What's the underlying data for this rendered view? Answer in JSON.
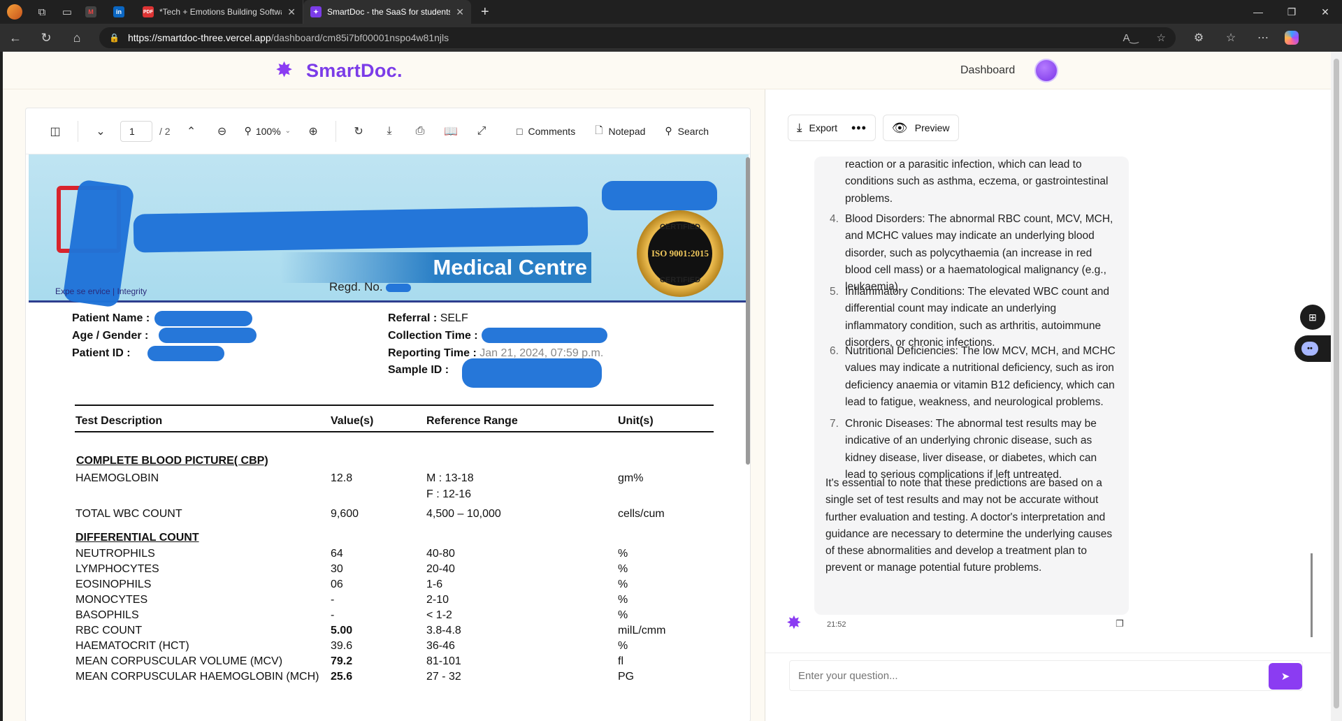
{
  "browser": {
    "tabs": [
      {
        "title": "",
        "favicon": "m-gmail"
      },
      {
        "title": "",
        "favicon": "linkedin"
      },
      {
        "title": "*Tech + Emotions Building Softwa",
        "favicon": "pdf"
      },
      {
        "title": "SmartDoc - the SaaS for students",
        "favicon": "smartdoc",
        "active": true
      }
    ],
    "url_host": "https://smartdoc-three.vercel.app",
    "url_path": "/dashboard/cm85i7bf00001nspo4w81njls"
  },
  "header": {
    "brand": "SmartDoc.",
    "nav_dashboard": "Dashboard"
  },
  "pdf_toolbar": {
    "page_current": "1",
    "page_total": "/ 2",
    "zoom": "100%",
    "comments": "Comments",
    "notepad": "Notepad",
    "search": "Search"
  },
  "report": {
    "lab_banner": "Medical Centre",
    "lab_tagline": "Expe se ervice | Integrity",
    "regd": "Regd. No.",
    "iso_top": "CERTIFIED",
    "iso_mid": "ISO 9001:2015",
    "iso_bot": "CERTIFIED",
    "patient_name_label": "Patient Name :",
    "age_gender_label": "Age / Gender :",
    "patient_id_label": "Patient ID :",
    "referral_label": "Referral :",
    "referral_value": "SELF",
    "collection_label": "Collection Time :",
    "reporting_label": "Reporting Time :",
    "reporting_value": "Jan 21, 2024, 07:59 p.m.",
    "sample_label": "Sample ID :",
    "columns": [
      "Test Description",
      "Value(s)",
      "Reference Range",
      "Unit(s)"
    ],
    "section_cbp": "COMPLETE BLOOD PICTURE( CBP)",
    "section_diff": "DIFFERENTIAL COUNT",
    "rows_top": [
      {
        "name": "HAEMOGLOBIN",
        "value": "12.8",
        "range": "M : 13-18",
        "range2": "F : 12-16",
        "unit": "gm%"
      },
      {
        "name": "TOTAL WBC COUNT",
        "value": "9,600",
        "range": "4,500 – 10,000",
        "unit": "cells/cum"
      }
    ],
    "rows_diff": [
      {
        "name": "NEUTROPHILS",
        "value": "64",
        "range": "40-80",
        "unit": "%"
      },
      {
        "name": "LYMPHOCYTES",
        "value": "30",
        "range": "20-40",
        "unit": "%"
      },
      {
        "name": "EOSINOPHILS",
        "value": "06",
        "range": "1-6",
        "unit": "%"
      },
      {
        "name": "MONOCYTES",
        "value": "-",
        "range": "2-10",
        "unit": "%"
      },
      {
        "name": "BASOPHILS",
        "value": "-",
        "range": "< 1-2",
        "unit": "%"
      },
      {
        "name": "RBC COUNT",
        "value": "5.00",
        "range": "3.8-4.8",
        "unit": "milL/cmm",
        "bold": true
      },
      {
        "name": "HAEMATOCRIT (HCT)",
        "value": "39.6",
        "range": "36-46",
        "unit": "%"
      },
      {
        "name": "MEAN CORPUSCULAR VOLUME (MCV)",
        "value": "79.2",
        "range": "81-101",
        "unit": "fl",
        "bold": true
      },
      {
        "name": "MEAN CORPUSCULAR HAEMOGLOBIN (MCH)",
        "value": "25.6",
        "range": "27 - 32",
        "unit": "PG",
        "bold": true
      }
    ]
  },
  "chat": {
    "export_label": "Export",
    "preview_label": "Preview",
    "list_items": [
      {
        "num": "",
        "text": "reaction or a parasitic infection, which can lead to conditions such as asthma, eczema, or gastrointestinal problems."
      },
      {
        "num": "4.",
        "text": "Blood Disorders: The abnormal RBC count, MCV, MCH, and MCHC values may indicate an underlying blood disorder, such as polycythaemia (an increase in red blood cell mass) or a haematological malignancy (e.g., leukaemia)."
      },
      {
        "num": "5.",
        "text": "Inflammatory Conditions: The elevated WBC count and differential count may indicate an underlying inflammatory condition, such as arthritis, autoimmune disorders, or chronic infections."
      },
      {
        "num": "6.",
        "text": "Nutritional Deficiencies: The low MCV, MCH, and MCHC values may indicate a nutritional deficiency, such as iron deficiency anaemia or vitamin B12 deficiency, which can lead to fatigue, weakness, and neurological problems."
      },
      {
        "num": "7.",
        "text": "Chronic Diseases: The abnormal test results may be indicative of an underlying chronic disease, such as kidney disease, liver disease, or diabetes, which can lead to serious complications if left untreated."
      }
    ],
    "closing_paragraph": "It's essential to note that these predictions are based on a single set of test results and may not be accurate without further evaluation and testing. A doctor's interpretation and guidance are necessary to determine the underlying causes of these abnormalities and develop a treatment plan to prevent or manage potential future problems.",
    "timestamp": "21:52",
    "input_placeholder": "Enter your question..."
  },
  "colors": {
    "brand": "#7b3ce8",
    "send_button": "#8b3cf2",
    "redaction": "#1f73d8"
  }
}
